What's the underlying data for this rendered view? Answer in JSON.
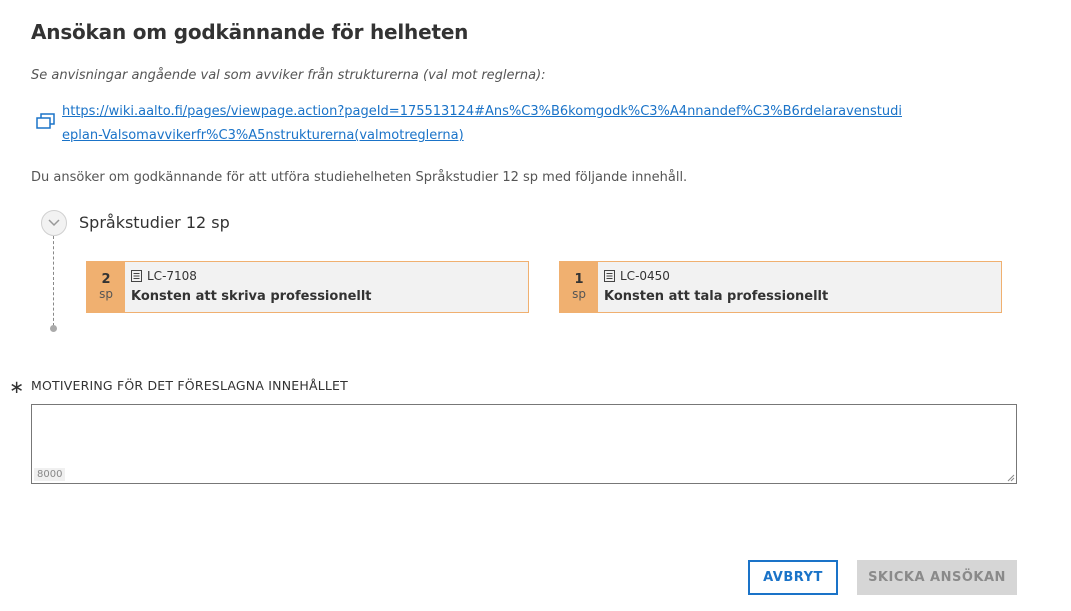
{
  "dialog": {
    "title": "Ansökan om godkännande för helheten",
    "instructions": "Se anvisningar angående val som avviker från strukturerna (val mot reglerna):",
    "link_text": "https://wiki.aalto.fi/pages/viewpage.action?pageId=175513124#Ans%C3%B6komgodk%C3%A4nnandef%C3%B6rdelaravenstudieplan-Valsomavvikerfr%C3%A5nstrukturerna(valmotreglerna)",
    "intro": "Du ansöker om godkännande för att utföra studiehelheten Språkstudier 12 sp med följande innehåll."
  },
  "module": {
    "title": "Språkstudier 12 sp",
    "courses": [
      {
        "credits": "2",
        "unit": "sp",
        "code": "LC-7108",
        "name": "Konsten att skriva professionellt"
      },
      {
        "credits": "1",
        "unit": "sp",
        "code": "LC-0450",
        "name": "Konsten att tala professionellt"
      }
    ]
  },
  "motivation": {
    "required_mark": "∗",
    "label": "MOTIVERING FÖR DET FÖRESLAGNA INNEHÅLLET",
    "value": "",
    "counter": "8000"
  },
  "buttons": {
    "cancel": "AVBRYT",
    "submit": "SKICKA ANSÖKAN"
  },
  "colors": {
    "accent": "#1a73c8",
    "credit_badge": "#f0b070",
    "disabled_button": "#d6d6d6"
  }
}
